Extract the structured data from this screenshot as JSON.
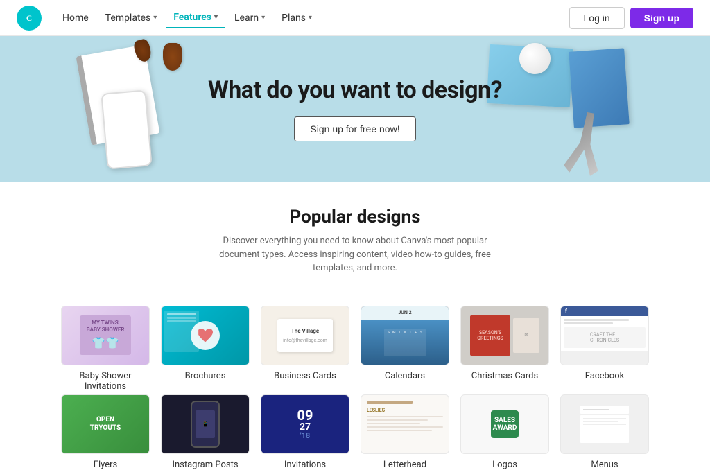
{
  "navbar": {
    "logo_alt": "Canva",
    "links": [
      {
        "id": "home",
        "label": "Home",
        "has_chevron": false,
        "active": false
      },
      {
        "id": "templates",
        "label": "Templates",
        "has_chevron": true,
        "active": false
      },
      {
        "id": "features",
        "label": "Features",
        "has_chevron": true,
        "active": true
      },
      {
        "id": "learn",
        "label": "Learn",
        "has_chevron": true,
        "active": false
      },
      {
        "id": "plans",
        "label": "Plans",
        "has_chevron": true,
        "active": false
      }
    ],
    "login_label": "Log in",
    "signup_label": "Sign up"
  },
  "hero": {
    "title": "What do you want to design?",
    "cta_label": "Sign up for free now!"
  },
  "popular": {
    "title": "Popular designs",
    "description": "Discover everything you need to know about Canva's most popular document types. Access inspiring content, video how-to guides, free templates, and more."
  },
  "designs_row1": [
    {
      "id": "baby-shower",
      "label": "Baby Shower Invitations",
      "thumb_type": "baby-shower"
    },
    {
      "id": "brochures",
      "label": "Brochures",
      "thumb_type": "brochure"
    },
    {
      "id": "business-cards",
      "label": "Business Cards",
      "thumb_type": "business"
    },
    {
      "id": "calendars",
      "label": "Calendars",
      "thumb_type": "calendar"
    },
    {
      "id": "christmas-cards",
      "label": "Christmas Cards",
      "thumb_type": "christmas"
    },
    {
      "id": "facebook",
      "label": "Facebook",
      "thumb_type": "facebook"
    }
  ],
  "designs_row2": [
    {
      "id": "flyers",
      "label": "Flyers",
      "thumb_type": "flyer"
    },
    {
      "id": "instagram",
      "label": "Instagram Posts",
      "thumb_type": "instagram"
    },
    {
      "id": "invitations",
      "label": "Invitations",
      "thumb_type": "invitation"
    },
    {
      "id": "letterhead",
      "label": "Letterhead",
      "thumb_type": "letterhead"
    },
    {
      "id": "logos",
      "label": "Logos",
      "thumb_type": "logo"
    },
    {
      "id": "menus",
      "label": "Menus",
      "thumb_type": "menu"
    }
  ]
}
